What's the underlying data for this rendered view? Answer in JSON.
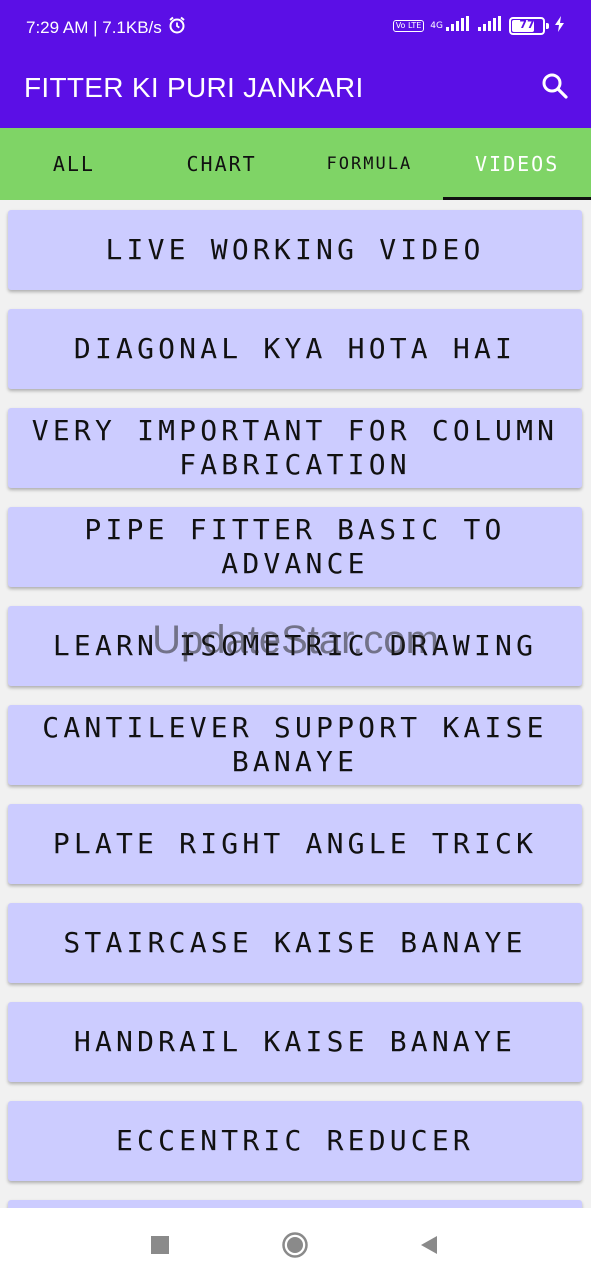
{
  "status_bar": {
    "time_speed": "7:29 AM | 7.1KB/s",
    "volte": "Vo LTE",
    "network": "4G",
    "battery": "77"
  },
  "app_bar": {
    "title": "FITTER KI PURI JANKARI"
  },
  "tabs": [
    {
      "label": "ALL"
    },
    {
      "label": "CHART"
    },
    {
      "label": "FORMULA"
    },
    {
      "label": "VIDEOS"
    }
  ],
  "active_tab": "VIDEOS",
  "videos": [
    {
      "label": "LIVE WORKING VIDEO"
    },
    {
      "label": "DIAGONAL KYA HOTA HAI"
    },
    {
      "label": "VERY IMPORTANT FOR COLUMN FABRICATION"
    },
    {
      "label": "PIPE FITTER BASIC TO ADVANCE"
    },
    {
      "label": "LEARN ISOMETRIC DRAWING"
    },
    {
      "label": "CANTILEVER SUPPORT KAISE BANAYE"
    },
    {
      "label": "PLATE RIGHT ANGLE TRICK"
    },
    {
      "label": "STAIRCASE KAISE BANAYE"
    },
    {
      "label": "HANDRAIL KAISE BANAYE"
    },
    {
      "label": "ECCENTRIC REDUCER"
    }
  ],
  "watermark": "UpdateStar.com",
  "colors": {
    "primary": "#5b0fe6",
    "tab_bar": "#7fd466",
    "item_bg": "#ccccff"
  },
  "icons": {
    "search": "search-icon",
    "alarm": "alarm-icon",
    "recents": "square-icon",
    "home": "circle-icon",
    "back": "triangle-icon"
  }
}
